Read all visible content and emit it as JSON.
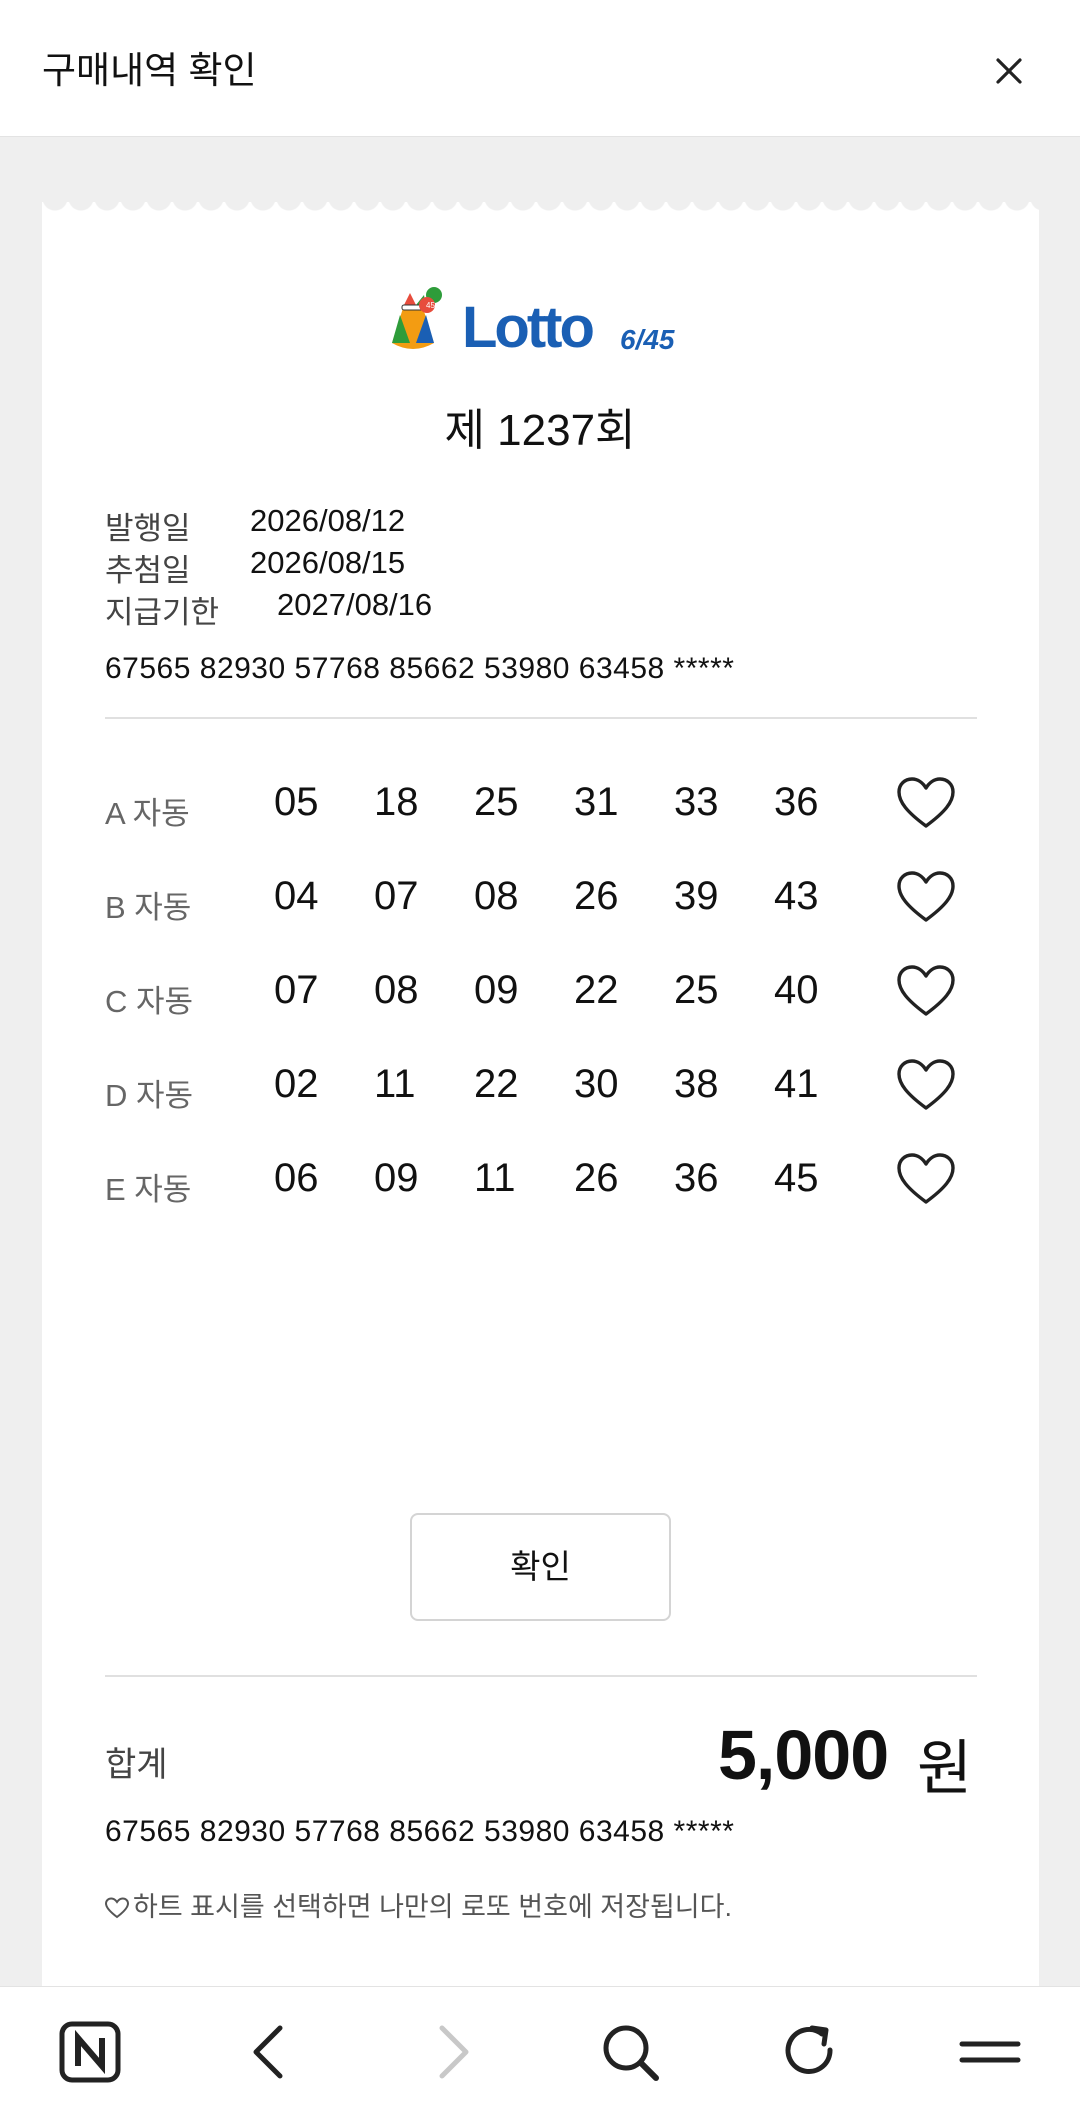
{
  "header": {
    "title": "구매내역 확인",
    "close_icon": "close-icon"
  },
  "ticket": {
    "logo": {
      "brand": "Lotto",
      "suffix": "6/45",
      "badge": "45"
    },
    "round": "제 1237회",
    "info": [
      {
        "label": "발행일",
        "value": "2026/08/12"
      },
      {
        "label": "추첨일",
        "value": "2026/08/15"
      },
      {
        "label": "지급기한",
        "value": "2027/08/16"
      }
    ],
    "serial": "67565  82930  57768  85662  53980  63458  *****",
    "games": [
      {
        "label": "A 자동",
        "numbers": [
          "05",
          "18",
          "25",
          "31",
          "33",
          "36"
        ]
      },
      {
        "label": "B 자동",
        "numbers": [
          "04",
          "07",
          "08",
          "26",
          "39",
          "43"
        ]
      },
      {
        "label": "C 자동",
        "numbers": [
          "07",
          "08",
          "09",
          "22",
          "25",
          "40"
        ]
      },
      {
        "label": "D 자동",
        "numbers": [
          "02",
          "11",
          "22",
          "30",
          "38",
          "41"
        ]
      },
      {
        "label": "E 자동",
        "numbers": [
          "06",
          "09",
          "11",
          "26",
          "36",
          "45"
        ]
      }
    ],
    "confirm_label": "확인",
    "total": {
      "label": "합계",
      "amount": "5,000",
      "unit": "원"
    },
    "serial_bottom": "67565  82930  57768  85662  53980  63458  *****",
    "notice": "하트 표시를 선택하면 나만의 로또 번호에 저장됩니다."
  },
  "browser_nav": {
    "icons": [
      "naver-home-icon",
      "back-icon",
      "forward-icon",
      "search-icon",
      "refresh-icon",
      "menu-icon"
    ]
  },
  "colors": {
    "background": "#efefef",
    "ticket": "#ffffff",
    "logo_blue": "#1a5fb4",
    "logo_green": "#7cc21c"
  }
}
